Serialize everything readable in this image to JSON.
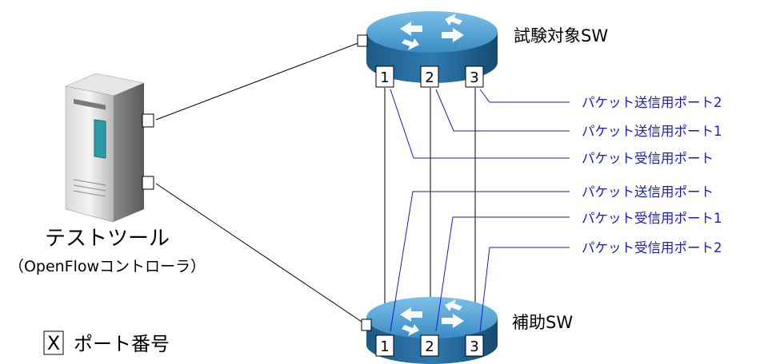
{
  "target_switch": {
    "label": "試験対象SW"
  },
  "aux_switch": {
    "label": "補助SW"
  },
  "tool": {
    "label": "テストツール",
    "sublabel": "（OpenFlowコントローラ）"
  },
  "target_ports": [
    "1",
    "2",
    "3"
  ],
  "aux_ports": [
    "1",
    "2",
    "3"
  ],
  "target_annotations": [
    "パケット送信用ポート2",
    "パケット送信用ポート1",
    "パケット受信用ポート"
  ],
  "aux_annotations": [
    "パケット送信用ポート",
    "パケット受信用ポート1",
    "パケット受信用ポート2"
  ],
  "legend": {
    "symbol": "X",
    "text": "ポート番号"
  },
  "colors": {
    "router_top": "#4aa0d0",
    "router_side": "#1f5f8f",
    "annotation": "#1a1acc"
  }
}
